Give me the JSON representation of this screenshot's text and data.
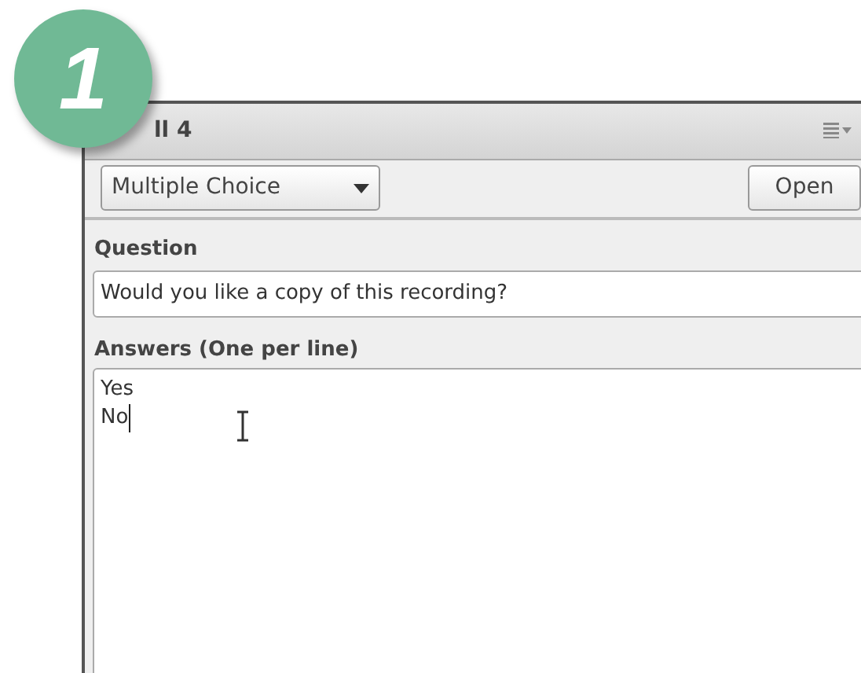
{
  "step_badge": "1",
  "panel": {
    "title": "ll 4"
  },
  "toolbar": {
    "question_type": "Multiple Choice",
    "open_button": "Open"
  },
  "question": {
    "label": "Question",
    "value": "Would you like a copy of this recording?"
  },
  "answers": {
    "label": "Answers (One per line)",
    "lines": [
      "Yes",
      "No"
    ]
  }
}
